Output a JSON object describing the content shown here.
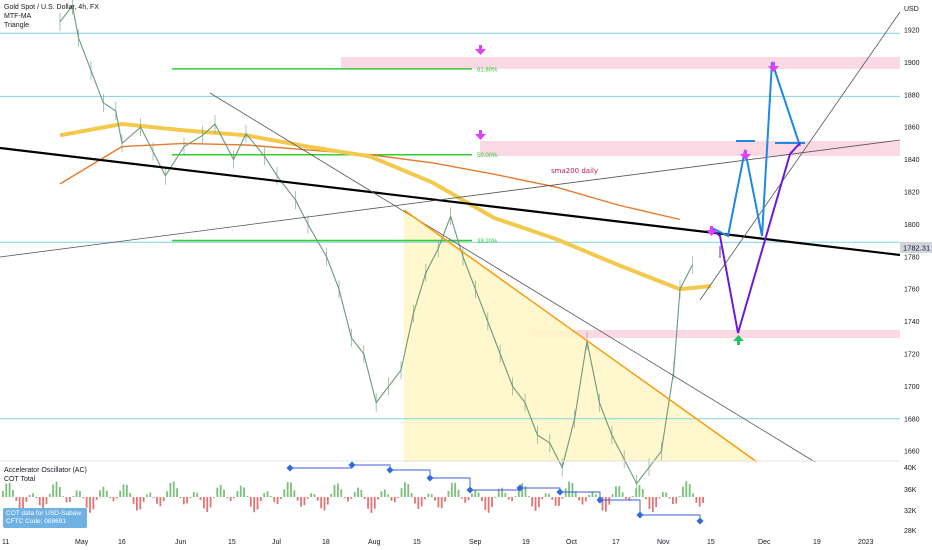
{
  "header": {
    "symbol_line": "Gold Spot / U.S. Dollar, 4h, FX",
    "indicator_1": "MTF-MA",
    "indicator_2": "Triangle"
  },
  "lower_panel": {
    "title": "Accelerator Oscillator (AC)",
    "subtitle": "COT Total",
    "badge_line1": "COT data for USD-Sabaw",
    "badge_line2": "CFTC Code: 088691"
  },
  "colors": {
    "fib_green": "#33cc33",
    "sma_yellow": "#f2c94c",
    "sma_orange": "#e87a2c",
    "trend_black": "#000000",
    "triangle_orange": "#f59e0b",
    "zone_pink": "#f8c8d8",
    "arrow_blue": "#1e88e5",
    "arrow_purple": "#6a1bd6",
    "marker_magenta": "#e040fb",
    "marker_green": "#22c55e",
    "price_candle": "#6a9a7a",
    "hline_cyan": "#7fd3e6",
    "price_tag": "#d1d4dc"
  },
  "chart_data": {
    "type": "line",
    "title": "Gold Spot / U.S. Dollar, 4h, FX",
    "y_axis_label": "USD",
    "ylim": [
      1645,
      1928
    ],
    "y_ticks": [
      1660,
      1680,
      1700,
      1720,
      1740,
      1760,
      1780,
      1800,
      1820,
      1840,
      1860,
      1880,
      1900,
      1920
    ],
    "x_tick_labels": [
      "11",
      "May",
      "16",
      "Jun",
      "15",
      "Jul",
      "18",
      "Aug",
      "15",
      "Sep",
      "19",
      "Oct",
      "17",
      "Nov",
      "15",
      "Dec",
      "19",
      "2023"
    ],
    "current_price": "1782.31",
    "price_series_trading_days": {
      "x": [
        0,
        4,
        6,
        10,
        14,
        18,
        20,
        26,
        30,
        34,
        40,
        46,
        50,
        56,
        60,
        66,
        70,
        76,
        80,
        86,
        90,
        94,
        98,
        102,
        106,
        110,
        114,
        118,
        122,
        126,
        130,
        134,
        138,
        142,
        146,
        150,
        154,
        158,
        162,
        166,
        170,
        174,
        178,
        182,
        186,
        190,
        194,
        198,
        200,
        204
      ],
      "y": [
        1925,
        1935,
        1915,
        1895,
        1875,
        1870,
        1850,
        1860,
        1845,
        1830,
        1848,
        1855,
        1862,
        1840,
        1856,
        1842,
        1830,
        1815,
        1800,
        1780,
        1760,
        1730,
        1720,
        1690,
        1700,
        1710,
        1745,
        1770,
        1785,
        1805,
        1780,
        1760,
        1740,
        1720,
        1700,
        1690,
        1670,
        1665,
        1650,
        1680,
        1728,
        1690,
        1670,
        1655,
        1640,
        1650,
        1660,
        1710,
        1760,
        1775
      ]
    },
    "sma200_daily": {
      "name": "sma200 daily",
      "x": [
        0,
        20,
        40,
        60,
        80,
        100,
        120,
        140,
        160,
        180,
        200,
        210
      ],
      "y": [
        1855,
        1862,
        1858,
        1855,
        1848,
        1842,
        1826,
        1804,
        1791,
        1775,
        1760,
        1762
      ]
    },
    "sma_orange": {
      "x": [
        0,
        20,
        40,
        60,
        80,
        100,
        120,
        140,
        160,
        180,
        200
      ],
      "y": [
        1825,
        1848,
        1850,
        1849,
        1846,
        1843,
        1838,
        1831,
        1823,
        1812,
        1803
      ]
    },
    "fibonacci": [
      {
        "label": "61.80%",
        "price": 1896
      },
      {
        "label": "50.00%",
        "price": 1843
      },
      {
        "label": "38.20%",
        "price": 1790
      }
    ],
    "horizontal_levels": [
      1918,
      1879,
      1789,
      1680
    ],
    "annotations": [
      "sma200 daily"
    ],
    "lower_axis_ticks": [
      "40K",
      "36K",
      "32K",
      "28K"
    ]
  }
}
